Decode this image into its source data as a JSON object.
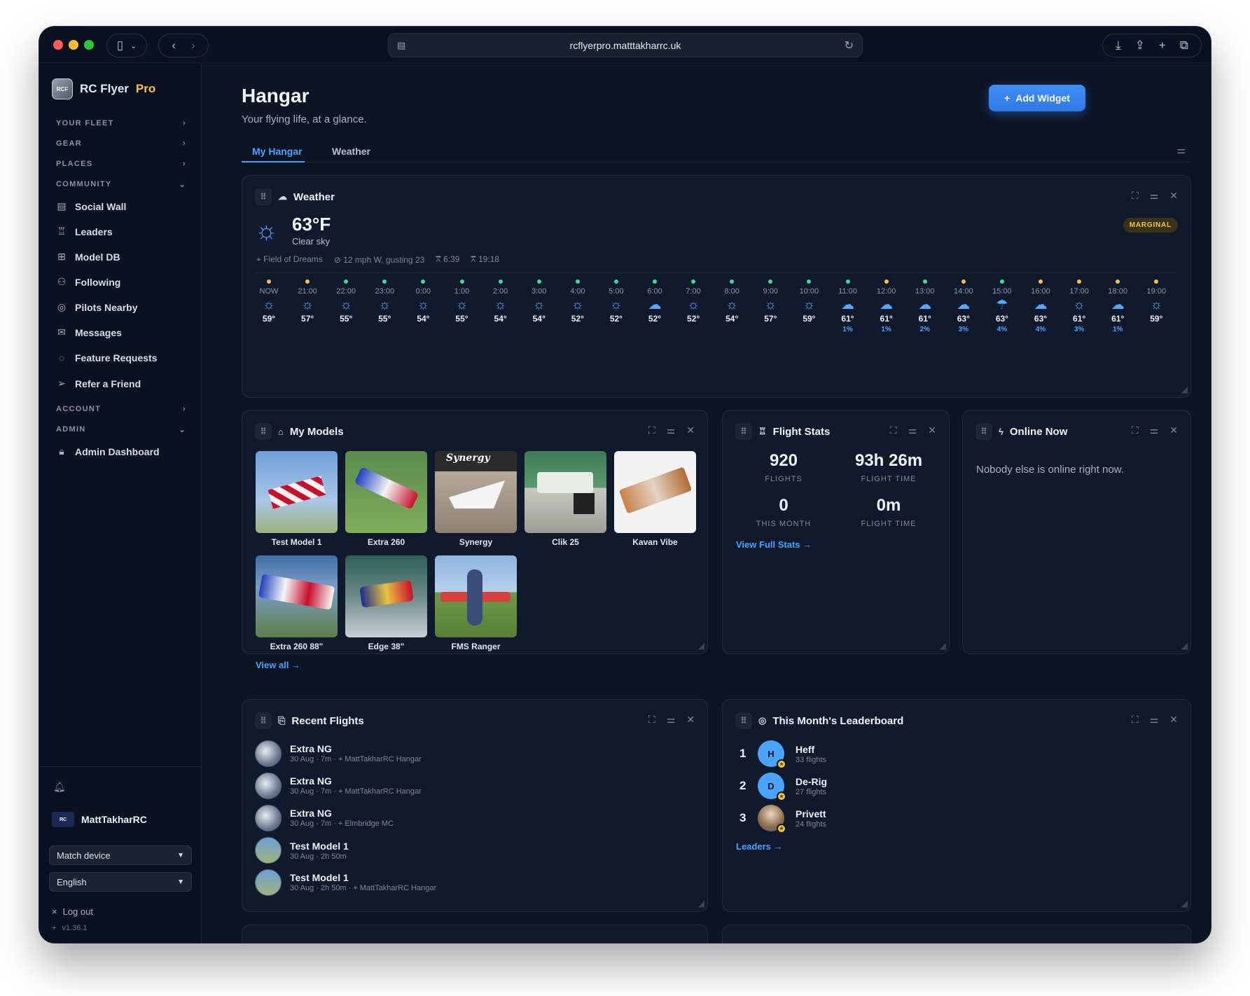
{
  "browser": {
    "url": "rcflyerpro.matttakharrc.uk"
  },
  "sidebar": {
    "brand": {
      "name": "RC Flyer",
      "pro": "Pro",
      "logo_text": "RCF"
    },
    "sections": {
      "fleet": "YOUR FLEET",
      "gear": "GEAR",
      "places": "PLACES",
      "community": "COMMUNITY",
      "account": "ACCOUNT",
      "admin": "ADMIN"
    },
    "community_items": [
      "Social Wall",
      "Leaders",
      "Model DB",
      "Following",
      "Pilots Nearby",
      "Messages",
      "Feature Requests",
      "Refer a Friend"
    ],
    "admin_items": [
      "Admin Dashboard"
    ],
    "user": {
      "name": "MattTakharRC"
    },
    "theme_select": "Match device",
    "language_select": "English",
    "logout": "Log out",
    "version": "v1.36.1"
  },
  "page": {
    "title": "Hangar",
    "subtitle": "Your flying life, at a glance.",
    "add_widget": "Add Widget",
    "tabs": [
      "My Hangar",
      "Weather"
    ],
    "active_tab": "My Hangar"
  },
  "weather": {
    "title": "Weather",
    "temp": "63°F",
    "condition": "Clear sky",
    "badge": "MARGINAL",
    "location": "Field of Dreams",
    "wind": "12 mph W, gusting 23",
    "sunrise": "6:39",
    "sunset": "19:18",
    "colors": {
      "dot_good": "#3ddc97",
      "dot_marginal": "#f5c542",
      "accent": "#4aa3ff"
    },
    "hours": [
      {
        "t": "NOW",
        "temp": "59°",
        "icon": "sun",
        "dot": "marginal",
        "p": ""
      },
      {
        "t": "21:00",
        "temp": "57°",
        "icon": "sun",
        "dot": "marginal",
        "p": ""
      },
      {
        "t": "22:00",
        "temp": "55°",
        "icon": "sun",
        "dot": "good",
        "p": ""
      },
      {
        "t": "23:00",
        "temp": "55°",
        "icon": "sun",
        "dot": "good",
        "p": ""
      },
      {
        "t": "0:00",
        "temp": "54°",
        "icon": "sun",
        "dot": "good",
        "p": ""
      },
      {
        "t": "1:00",
        "temp": "55°",
        "icon": "sun",
        "dot": "good",
        "p": ""
      },
      {
        "t": "2:00",
        "temp": "54°",
        "icon": "sun",
        "dot": "good",
        "p": ""
      },
      {
        "t": "3:00",
        "temp": "54°",
        "icon": "sun",
        "dot": "good",
        "p": ""
      },
      {
        "t": "4:00",
        "temp": "52°",
        "icon": "sun",
        "dot": "good",
        "p": ""
      },
      {
        "t": "5:00",
        "temp": "52°",
        "icon": "sun",
        "dot": "good",
        "p": ""
      },
      {
        "t": "6:00",
        "temp": "52°",
        "icon": "cloud",
        "dot": "good",
        "p": ""
      },
      {
        "t": "7:00",
        "temp": "52°",
        "icon": "sun",
        "dot": "good",
        "p": ""
      },
      {
        "t": "8:00",
        "temp": "54°",
        "icon": "sun",
        "dot": "good",
        "p": ""
      },
      {
        "t": "9:00",
        "temp": "57°",
        "icon": "sun",
        "dot": "good",
        "p": ""
      },
      {
        "t": "10:00",
        "temp": "59°",
        "icon": "sun",
        "dot": "good",
        "p": ""
      },
      {
        "t": "11:00",
        "temp": "61°",
        "icon": "cloud",
        "dot": "good",
        "p": "1%"
      },
      {
        "t": "12:00",
        "temp": "61°",
        "icon": "cloud",
        "dot": "marginal",
        "p": "1%"
      },
      {
        "t": "13:00",
        "temp": "61°",
        "icon": "cloud",
        "dot": "good",
        "p": "2%"
      },
      {
        "t": "14:00",
        "temp": "63°",
        "icon": "cloud",
        "dot": "marginal",
        "p": "3%"
      },
      {
        "t": "15:00",
        "temp": "63°",
        "icon": "rain",
        "dot": "good",
        "p": "4%"
      },
      {
        "t": "16:00",
        "temp": "63°",
        "icon": "cloud",
        "dot": "marginal",
        "p": "4%"
      },
      {
        "t": "17:00",
        "temp": "61°",
        "icon": "sun",
        "dot": "marginal",
        "p": "3%"
      },
      {
        "t": "18:00",
        "temp": "61°",
        "icon": "cloud",
        "dot": "marginal",
        "p": "1%"
      },
      {
        "t": "19:00",
        "temp": "59°",
        "icon": "sun",
        "dot": "marginal",
        "p": ""
      }
    ]
  },
  "models": {
    "title": "My Models",
    "items": [
      "Test Model 1",
      "Extra 260",
      "Synergy",
      "Clik 25",
      "Kavan Vibe",
      "Extra 260 88\"",
      "Edge 38\"",
      "FMS Ranger"
    ],
    "view_all": "View all"
  },
  "stats": {
    "title": "Flight Stats",
    "flights": "920",
    "flights_label": "FLIGHTS",
    "time": "93h 26m",
    "time_label": "FLIGHT TIME",
    "month": "0",
    "month_label": "THIS MONTH",
    "month_time": "0m",
    "month_time_label": "FLIGHT TIME",
    "link": "View Full Stats"
  },
  "online": {
    "title": "Online Now",
    "empty": "Nobody else is online right now."
  },
  "flights": {
    "title": "Recent Flights",
    "items": [
      {
        "name": "Extra NG",
        "meta": "30 Aug · 7m · ",
        "loc": "MattTakharRC Hangar"
      },
      {
        "name": "Extra NG",
        "meta": "30 Aug · 7m · ",
        "loc": "MattTakharRC Hangar"
      },
      {
        "name": "Extra NG",
        "meta": "30 Aug · 7m · ",
        "loc": "Elmbridge MC"
      },
      {
        "name": "Test Model 1",
        "meta": "30 Aug · 2h 50m",
        "loc": ""
      },
      {
        "name": "Test Model 1",
        "meta": "30 Aug · 2h 50m · ",
        "loc": "MattTakharRC Hangar"
      }
    ]
  },
  "leaderboard": {
    "title": "This Month's Leaderboard",
    "items": [
      {
        "rank": "1",
        "initial": "H",
        "name": "Heff",
        "flights": "33 flights",
        "color": "#4aa3ff"
      },
      {
        "rank": "2",
        "initial": "D",
        "name": "De-Rig",
        "flights": "27 flights",
        "color": "#4aa3ff"
      },
      {
        "rank": "3",
        "initial": "",
        "name": "Privett",
        "flights": "24 flights",
        "color": "#c9a27a"
      }
    ],
    "link": "Leaders"
  }
}
